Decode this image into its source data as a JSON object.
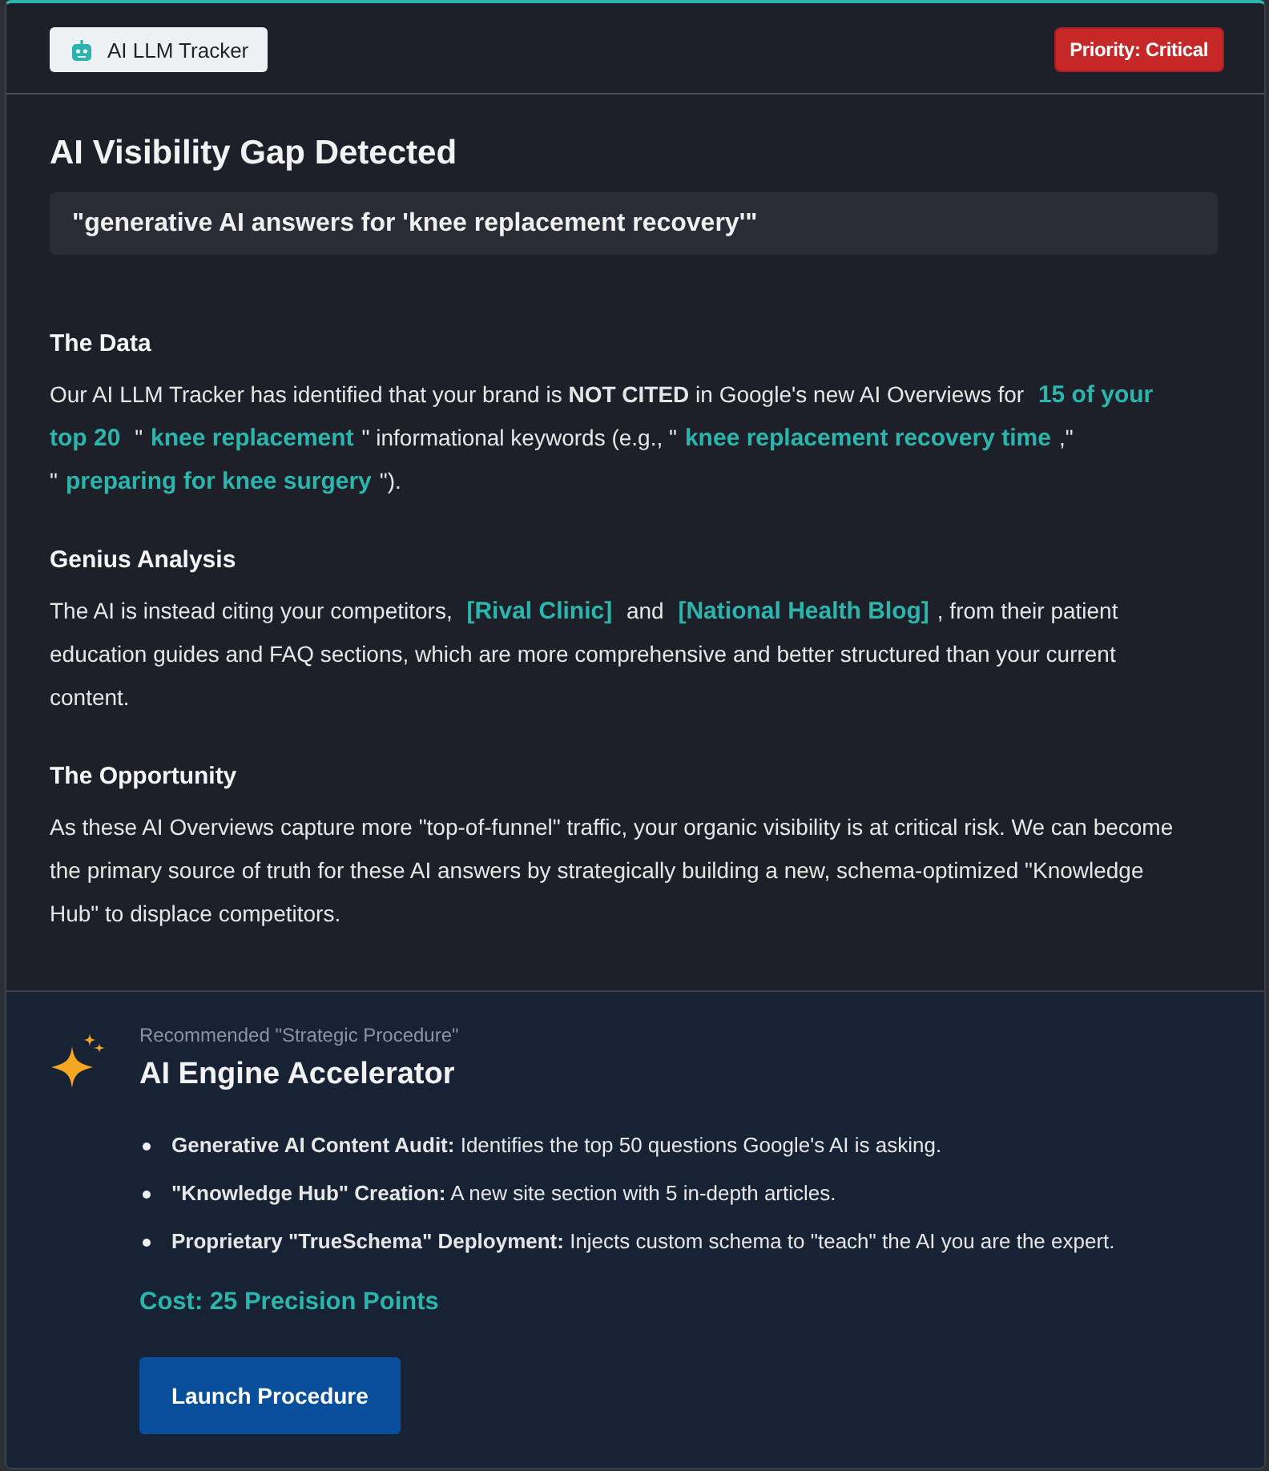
{
  "header": {
    "source_badge": "AI LLM Tracker",
    "priority_badge": "Priority: Critical"
  },
  "alert": {
    "title": "AI Visibility Gap Detected",
    "query": "\"generative AI answers for 'knee replacement recovery'\""
  },
  "sections": [
    {
      "heading": "The Data",
      "segments": [
        {
          "kind": "text",
          "text": "Our AI LLM Tracker has identified that your brand is **NOT CITED** in Google's new AI Overviews for "
        },
        {
          "kind": "highlight",
          "text": "15 of your top 20"
        },
        {
          "kind": "text",
          "text": " \""
        },
        {
          "kind": "highlight",
          "text": "knee replacement"
        },
        {
          "kind": "text",
          "text": "\" informational keywords (e.g., \""
        },
        {
          "kind": "highlight",
          "text": "knee replacement recovery time"
        },
        {
          "kind": "text",
          "text": ",\" \""
        },
        {
          "kind": "highlight",
          "text": "preparing for knee surgery"
        },
        {
          "kind": "text",
          "text": "\")."
        }
      ]
    },
    {
      "heading": "Genius Analysis",
      "segments": [
        {
          "kind": "text",
          "text": "The AI is instead citing your competitors, "
        },
        {
          "kind": "highlight",
          "text": "[Rival Clinic]"
        },
        {
          "kind": "text",
          "text": " and "
        },
        {
          "kind": "highlight",
          "text": "[National Health Blog]"
        },
        {
          "kind": "text",
          "text": ", from their patient education guides and FAQ sections, which are more comprehensive and better structured than your current content."
        }
      ]
    },
    {
      "heading": "The Opportunity",
      "segments": [
        {
          "kind": "text",
          "text": "As these AI Overviews capture more \"top-of-funnel\" traffic, your organic visibility is at critical risk. We can become the primary source of truth for these AI answers by strategically building a new, schema-optimized \"Knowledge Hub\" to displace competitors."
        }
      ]
    }
  ],
  "recommendation": {
    "eyebrow": "Recommended \"Strategic Procedure\"",
    "title": "AI Engine Accelerator",
    "steps": [
      "**Generative AI Content Audit:** Identifies the top 50 questions Google's AI is asking.",
      "**\"Knowledge Hub\" Creation:** A new site section with 5 in-depth articles.",
      "**Proprietary \"TrueSchema\" Deployment:** Injects custom schema to \"teach\" the AI you are the expert."
    ],
    "cost": "Cost: 25 Precision Points",
    "button": "Launch Procedure"
  }
}
